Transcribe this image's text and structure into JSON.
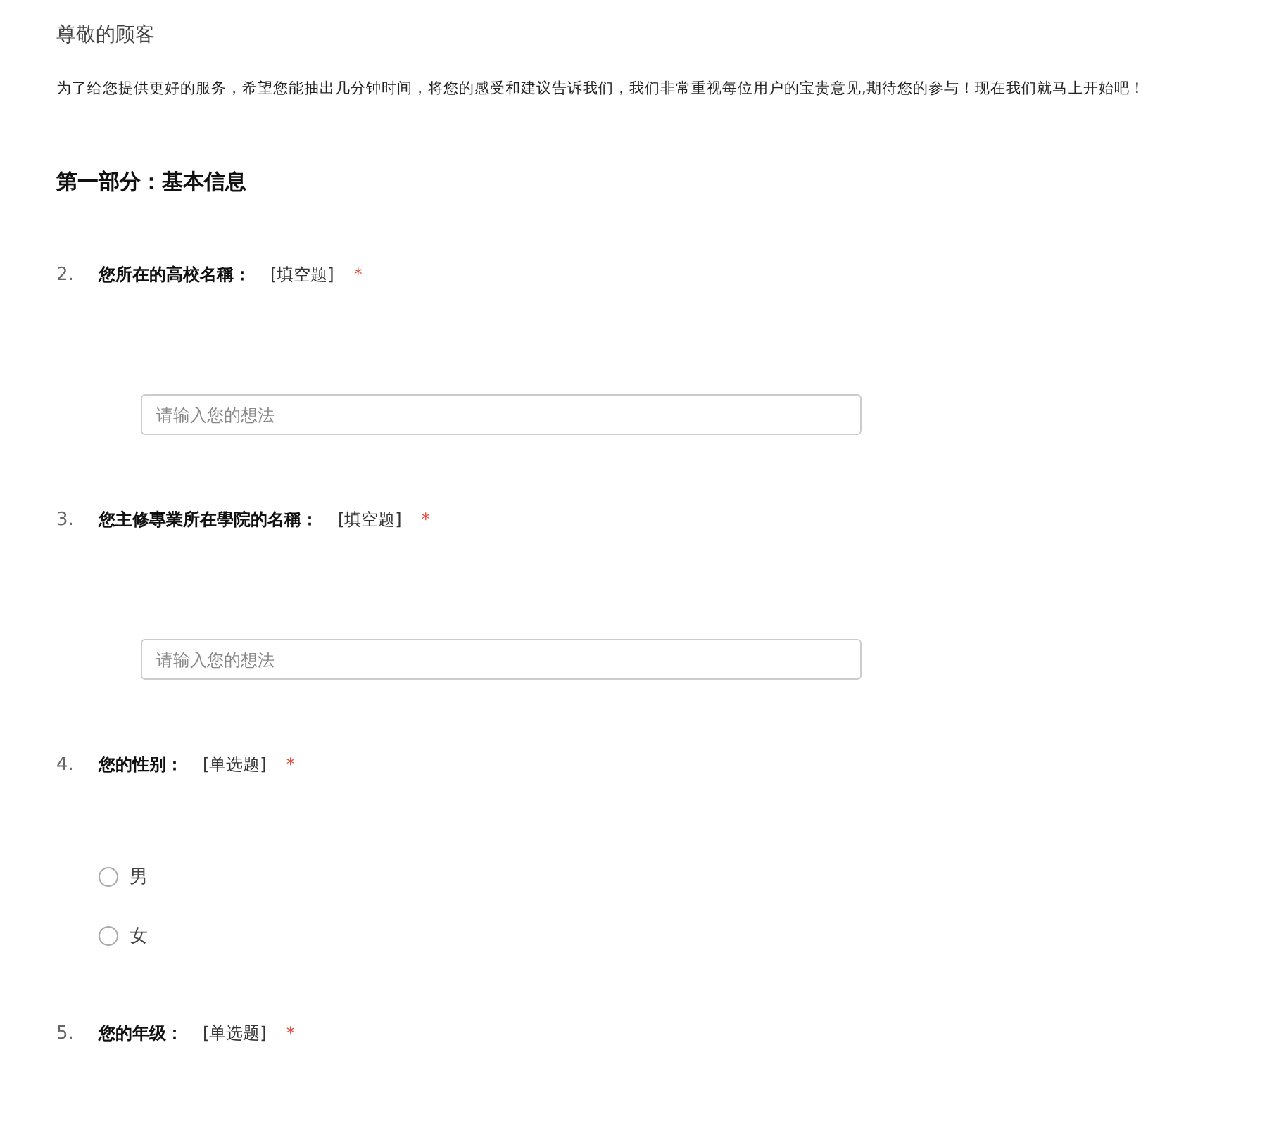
{
  "greeting": "尊敬的顾客",
  "intro": "为了给您提供更好的服务，希望您能抽出几分钟时间，将您的感受和建议告诉我们，我们非常重视每位用户的宝贵意见,期待您的参与！现在我们就马上开始吧！",
  "section_title": "第一部分：基本信息",
  "questions": [
    {
      "number": "2.",
      "title": "您所在的高校名稱：",
      "type_label": "[填空题]",
      "required_mark": "*",
      "kind": "text",
      "placeholder": "请输入您的想法"
    },
    {
      "number": "3.",
      "title": "您主修專業所在學院的名稱：",
      "type_label": "[填空题]",
      "required_mark": "*",
      "kind": "text",
      "placeholder": "请输入您的想法"
    },
    {
      "number": "4.",
      "title": "您的性别：",
      "type_label": "[单选题]",
      "required_mark": "*",
      "kind": "radio",
      "options": [
        {
          "label": "男",
          "selected": false
        },
        {
          "label": "女",
          "selected": false
        }
      ]
    },
    {
      "number": "5.",
      "title": "您的年级：",
      "type_label": "[单选题]",
      "required_mark": "*",
      "kind": "radio"
    }
  ]
}
